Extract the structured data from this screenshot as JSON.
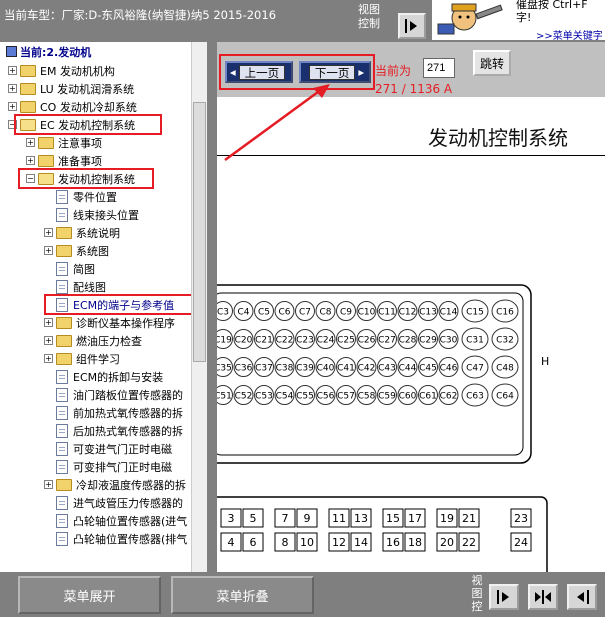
{
  "header": {
    "car_title": "当前车型：厂家:D-东风裕隆(纳智捷)纳5 2015-2016",
    "view_control_label": "视图控制"
  },
  "banner": {
    "line1": "催盘按   Ctrl+F",
    "line2": "字!",
    "link": ">>菜单关键字"
  },
  "tree": {
    "header": "当前:2.发动机",
    "items": [
      {
        "label": "EM 发动机机构",
        "type": "folder",
        "level": 0,
        "state": "collapsed"
      },
      {
        "label": "LU 发动机润滑系统",
        "type": "folder",
        "level": 0,
        "state": "collapsed"
      },
      {
        "label": "CO 发动机冷却系统",
        "type": "folder",
        "level": 0,
        "state": "collapsed"
      },
      {
        "label": "EC 发动机控制系统",
        "type": "folder",
        "level": 0,
        "state": "expanded"
      },
      {
        "label": "注意事项",
        "type": "folder",
        "level": 1,
        "state": "collapsed"
      },
      {
        "label": "准备事项",
        "type": "folder",
        "level": 1,
        "state": "collapsed"
      },
      {
        "label": "发动机控制系统",
        "type": "folder",
        "level": 1,
        "state": "expanded"
      },
      {
        "label": "零件位置",
        "type": "doc",
        "level": 2
      },
      {
        "label": "线束接头位置",
        "type": "doc",
        "level": 2
      },
      {
        "label": "系统说明",
        "type": "folder",
        "level": 2,
        "state": "collapsed"
      },
      {
        "label": "系统图",
        "type": "folder",
        "level": 2,
        "state": "collapsed"
      },
      {
        "label": "简图",
        "type": "doc",
        "level": 2
      },
      {
        "label": "配线图",
        "type": "doc",
        "level": 2
      },
      {
        "label": "ECM的端子与参考值",
        "type": "doc",
        "level": 2,
        "selected": true
      },
      {
        "label": "诊断仪基本操作程序",
        "type": "folder",
        "level": 2,
        "state": "collapsed"
      },
      {
        "label": "燃油压力检查",
        "type": "folder",
        "level": 2,
        "state": "collapsed"
      },
      {
        "label": "组件学习",
        "type": "folder",
        "level": 2,
        "state": "collapsed"
      },
      {
        "label": "ECM的拆卸与安装",
        "type": "doc",
        "level": 2
      },
      {
        "label": "油门踏板位置传感器的",
        "type": "doc",
        "level": 2
      },
      {
        "label": "前加热式氧传感器的拆",
        "type": "doc",
        "level": 2
      },
      {
        "label": "后加热式氧传感器的拆",
        "type": "doc",
        "level": 2
      },
      {
        "label": "可变进气门正时电磁",
        "type": "doc",
        "level": 2
      },
      {
        "label": "可变排气门正时电磁",
        "type": "doc",
        "level": 2
      },
      {
        "label": "冷却液温度传感器的拆",
        "type": "folder",
        "level": 2,
        "state": "collapsed"
      },
      {
        "label": "进气歧管压力传感器的",
        "type": "doc",
        "level": 2
      },
      {
        "label": "凸轮轴位置传感器(进气",
        "type": "doc",
        "level": 2
      },
      {
        "label": "凸轮轴位置传感器(排气",
        "type": "doc",
        "level": 2
      }
    ]
  },
  "doc_toolbar": {
    "prev_label": "上一页",
    "next_label": "下一页",
    "current_label": "当前为",
    "page_value": "271",
    "jump_label": "跳转",
    "page_count": "271 / 1136 A"
  },
  "document": {
    "heading": "发动机控制系统",
    "side_letter": "H",
    "connector_top_pins": [
      [
        "C3",
        "C4",
        "C5",
        "C6",
        "C7",
        "C8",
        "C9",
        "C10",
        "C11",
        "C12",
        "C13",
        "C14",
        "C15",
        "C16"
      ],
      [
        "C19",
        "C20",
        "C21",
        "C22",
        "C23",
        "C24",
        "C25",
        "C26",
        "C27",
        "C28",
        "C29",
        "C30",
        "C31",
        "C32"
      ],
      [
        "C35",
        "C36",
        "C37",
        "C38",
        "C39",
        "C40",
        "C41",
        "C42",
        "C43",
        "C44",
        "C45",
        "C46",
        "C47",
        "C48"
      ],
      [
        "C51",
        "C52",
        "C53",
        "C54",
        "C55",
        "C56",
        "C57",
        "C58",
        "C59",
        "C60",
        "C61",
        "C62",
        "C63",
        "C64"
      ]
    ],
    "connector_bottom_pins": [
      [
        "3",
        "5",
        "7",
        "9",
        "11",
        "13",
        "15",
        "17",
        "19",
        "21",
        "23"
      ],
      [
        "4",
        "6",
        "8",
        "10",
        "12",
        "14",
        "16",
        "18",
        "20",
        "22",
        "24"
      ]
    ]
  },
  "footer": {
    "expand_label": "菜单展开",
    "collapse_label": "菜单折叠",
    "view_control_label": "视图控"
  },
  "colors": {
    "accent_red": "#e51c23",
    "nav_blue": "#1a2f6e",
    "tree_header": "#00008b"
  }
}
